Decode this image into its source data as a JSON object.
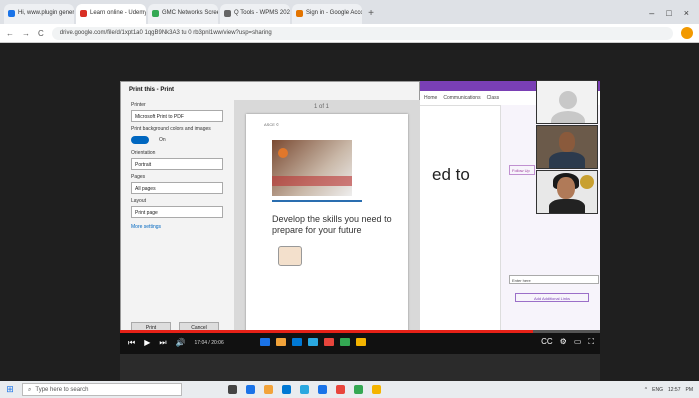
{
  "browser": {
    "tabs": [
      {
        "label": "Hi, www.plugin generator Bl...",
        "color": "#1a73e8",
        "active": false
      },
      {
        "label": "Learn online - Udemy ×",
        "color": "#d93025",
        "active": true
      },
      {
        "label": "GMC Networks Screen...",
        "color": "#34a853",
        "active": false
      },
      {
        "label": "Q  Tools - WPMS 2023 Cl...",
        "color": "#666666",
        "active": false
      },
      {
        "label": "Sign in - Google Accounts",
        "color": "#e37400",
        "active": false
      }
    ],
    "new_tab": "+",
    "window_controls": [
      "–",
      "□",
      "×"
    ],
    "nav": [
      "←",
      "→",
      "C"
    ],
    "url": "drive.google.com/file/d/1xpt1a0 1qgB9Nk3A3 tu 0 rb3pnl1ww/view?usp=sharing"
  },
  "print_dialog": {
    "title": "Print this - Print",
    "printer_label": "Printer",
    "printer_value": "Microsoft Print to PDF",
    "background_label": "Print background colors and images",
    "toggle_label": "On",
    "orientation_label": "Orientation",
    "orientation_value": "Portrait",
    "pages_label": "Pages",
    "pages_value": "All pages",
    "layout_label": "Layout",
    "layout_value": "Print page",
    "more_settings": "More settings",
    "print_button": "Print",
    "cancel_button": "Cancel",
    "preview_tools": "1 of 1",
    "page_small": "ASCE ©",
    "page_heading": "Develop the skills you need to prepare for your future"
  },
  "app_behind": {
    "tabs": [
      "Home",
      "Communications",
      "Class"
    ],
    "big_text": "ed to",
    "side_chip": "Follow Up",
    "side_input": "Enter here",
    "side_button": "Add Additional Links"
  },
  "player": {
    "progress": 0.86,
    "controls": [
      "⏮",
      "▶",
      "⏭",
      "🔊"
    ],
    "time": "17:04 / 20:06",
    "right_controls": [
      "CC",
      "⚙",
      "▭",
      "⛶"
    ]
  },
  "taskbar": {
    "start": "⊞",
    "search_placeholder": "Type here to search",
    "icons": [
      "#444444",
      "#1a73e8",
      "#f2a33a",
      "#0078d4",
      "#2aa8e0",
      "#1a73e8",
      "#e8453c",
      "#34a853",
      "#f4b400"
    ],
    "tray": [
      "^",
      "ENG",
      "12:57",
      "PM"
    ]
  },
  "colors": {
    "purple": "#7a3fb5",
    "progress_red": "#e62117"
  }
}
